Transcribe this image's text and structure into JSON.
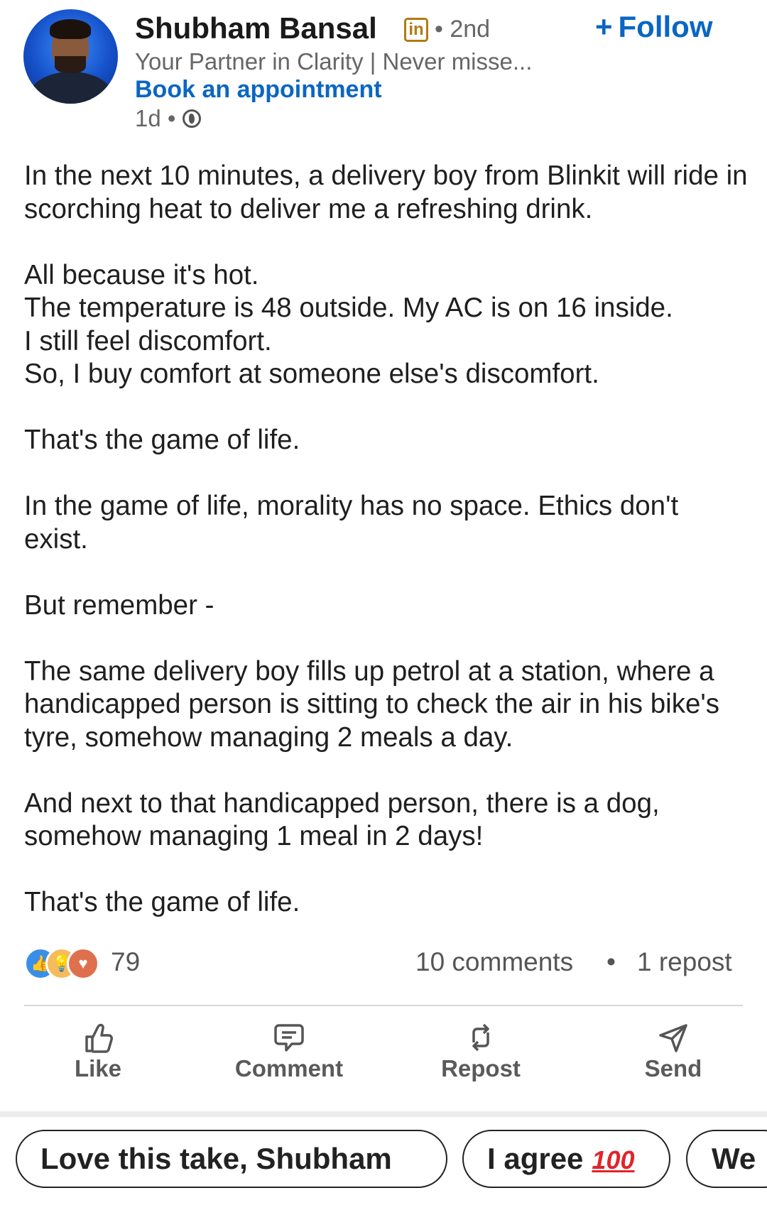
{
  "author": {
    "name": "Shubham Bansal",
    "badge": "in",
    "degree": "• 2nd",
    "headline": "Your Partner in Clarity | Never misse...",
    "cta": "Book an appointment",
    "time": "1d •",
    "follow_label": "Follow",
    "follow_plus": "+"
  },
  "post": {
    "paragraphs": [
      "In the next 10 minutes, a delivery boy from Blinkit will ride in scorching heat to deliver me a refreshing drink.",
      "All because it's hot.\nThe temperature is 48 outside. My AC is on 16 inside.\nI still feel discomfort.\nSo, I buy comfort at someone else's discomfort.",
      "That's the game of life.",
      "In the game of life, morality has no space. Ethics don't exist.",
      "But remember -",
      "The same delivery boy fills up petrol at a station, where a handicapped person is sitting to check the air in his bike's tyre, somehow managing 2 meals a day.",
      "And next to that handicapped person, there is a dog, somehow managing 1 meal in 2 days!",
      "That's the game of life."
    ]
  },
  "stats": {
    "reaction_count": "79",
    "comments": "10 comments",
    "separator": "•",
    "reposts": "1 repost"
  },
  "actions": {
    "like": "Like",
    "comment": "Comment",
    "repost": "Repost",
    "send": "Send"
  },
  "suggestions": {
    "chip1": "Love this take, Shubham",
    "chip2": "I agree",
    "chip2_emoji": "100",
    "chip3": "We"
  },
  "colors": {
    "accent": "#0a66c2",
    "text": "#1a1a1a",
    "muted": "#666666"
  }
}
